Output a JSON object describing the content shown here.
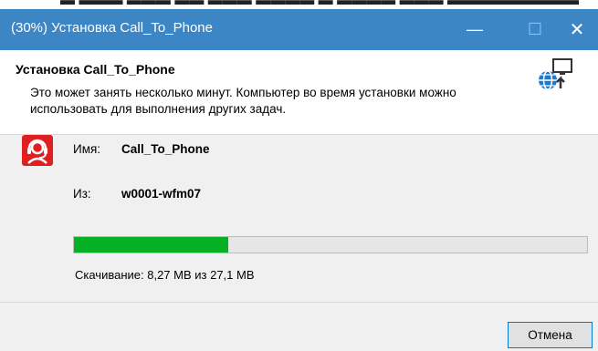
{
  "window": {
    "title": "(30%) Установка Call_To_Phone"
  },
  "titlebar": {
    "minimize": "—",
    "maximize": "☐",
    "close": "✕"
  },
  "header": {
    "title": "Установка Call_To_Phone",
    "description": "Это может занять несколько минут. Компьютер во время установки можно использовать для выполнения других задач."
  },
  "details": {
    "name_label": "Имя:",
    "name_value": "Call_To_Phone",
    "from_label": "Из:",
    "from_value": "w0001-wfm07"
  },
  "progress": {
    "fraction": 0.3,
    "status": "Скачивание: 8,27 MB из 27,1 MB"
  },
  "buttons": {
    "cancel": "Отмена"
  },
  "colors": {
    "titlebar": "#3d86c6",
    "progress_fill": "#06b025",
    "app_icon": "#e02020",
    "button_border": "#0078d7"
  },
  "icons": {
    "header": "globe-install-icon",
    "app": "headset-person-icon"
  }
}
